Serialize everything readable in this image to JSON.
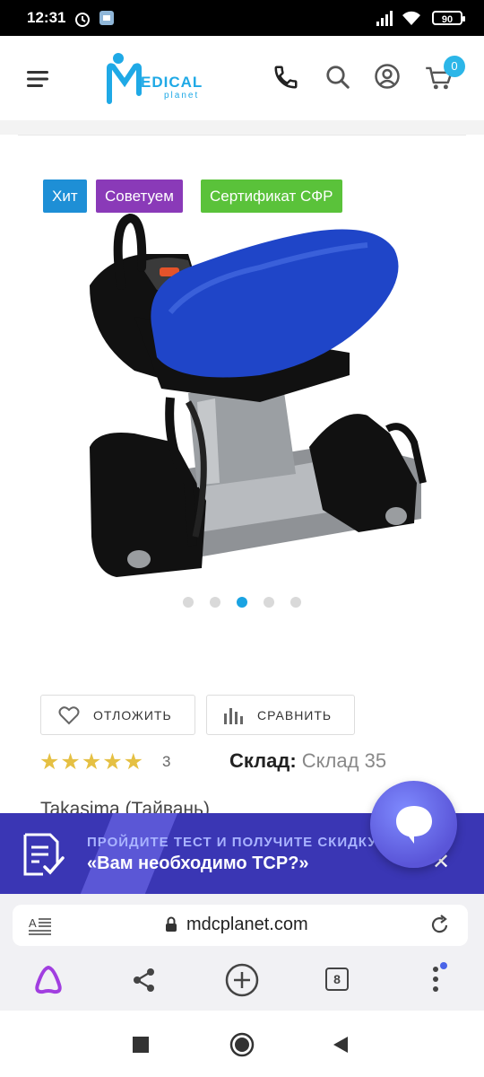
{
  "status_bar": {
    "time": "12:31",
    "battery": "90"
  },
  "header": {
    "logo_text": "EDICAL",
    "logo_sub": "planet",
    "cart_count": "0"
  },
  "badges": [
    "Хит",
    "Советуем",
    "Сертификат СФР"
  ],
  "colors": {
    "hit": "#1e8fd6",
    "recommend": "#8a3ab8",
    "cert": "#5ac23a",
    "accent": "#2cb6e8",
    "banner": "#3a36b4"
  },
  "gallery": {
    "dots": 5,
    "active_dot": 3
  },
  "actions": {
    "postpone": "ОТЛОЖИТЬ",
    "compare": "СРАВНИТЬ"
  },
  "rating": {
    "stars": "★★★★★",
    "value": 5,
    "reviews": "3"
  },
  "stock": {
    "label": "Склад:",
    "value": "Склад 35"
  },
  "brand": "Takasima (Тайвань)",
  "promo": {
    "title": "ПРОЙДИТЕ ТЕСТ И ПОЛУЧИТЕ СКИДКУ",
    "subtitle": "«Вам необходимо ТСР?»"
  },
  "browser": {
    "url": "mdcplanet.com",
    "tabs": "8"
  }
}
